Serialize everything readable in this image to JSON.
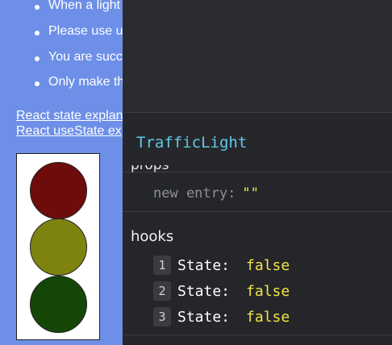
{
  "app": {
    "instructions": [
      "When a light",
      "Please use u",
      "You are succ",
      "Only make th"
    ],
    "links": [
      "React state explan",
      "React useState ex"
    ],
    "traffic_light": {
      "lamps": [
        {
          "name": "red",
          "color": "#6e0c0c"
        },
        {
          "name": "yellow",
          "color": "#7e830f"
        },
        {
          "name": "green",
          "color": "#144707"
        }
      ]
    }
  },
  "devtools": {
    "component_name": "TrafficLight",
    "props_title": "props",
    "props": [
      {
        "key": "new entry",
        "value": "\"\""
      }
    ],
    "hooks_title": "hooks",
    "hooks": [
      {
        "index": "1",
        "key": "State:",
        "value": "false"
      },
      {
        "index": "2",
        "key": "State:",
        "value": "false"
      },
      {
        "index": "3",
        "key": "State:",
        "value": "false"
      }
    ]
  }
}
